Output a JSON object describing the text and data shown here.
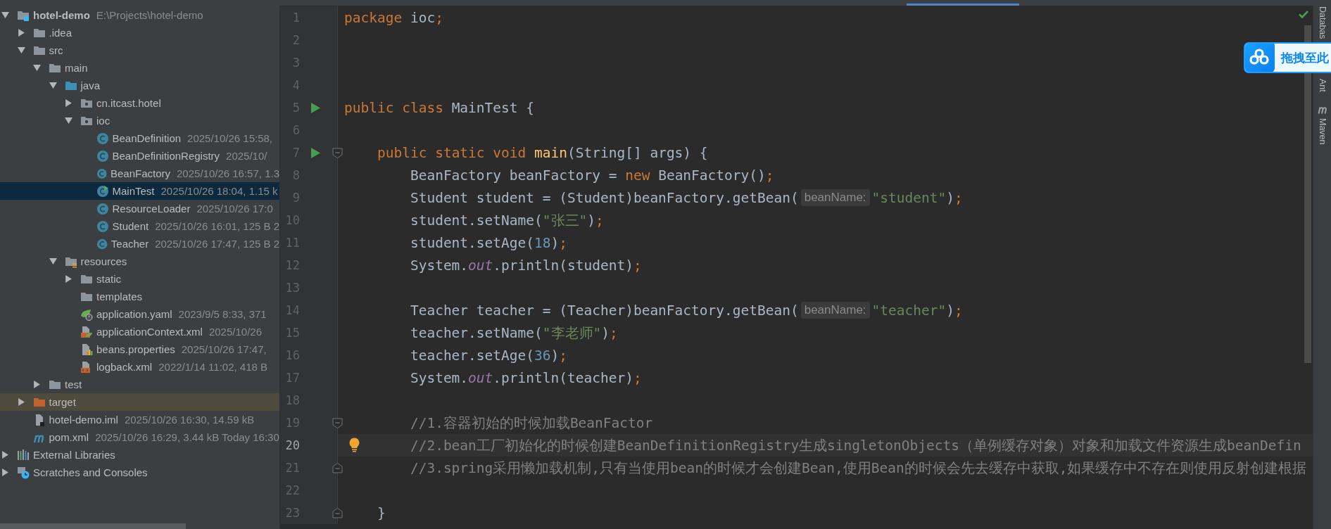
{
  "project_tree": {
    "items": [
      {
        "label": "hotel-demo",
        "meta": "E:\\Projects\\hotel-demo",
        "kind": "module",
        "expanded": true,
        "selected": false,
        "marked": false,
        "children": [
          {
            "label": ".idea",
            "kind": "folder",
            "expanded": false,
            "selected": false,
            "marked": false
          },
          {
            "label": "src",
            "kind": "folder",
            "expanded": true,
            "selected": false,
            "marked": false,
            "children": [
              {
                "label": "main",
                "kind": "folder",
                "expanded": true,
                "selected": false,
                "marked": false,
                "children": [
                  {
                    "label": "java",
                    "kind": "source",
                    "expanded": true,
                    "selected": false,
                    "marked": false,
                    "children": [
                      {
                        "label": "cn.itcast.hotel",
                        "kind": "package",
                        "expanded": false,
                        "selected": false,
                        "marked": false
                      },
                      {
                        "label": "ioc",
                        "kind": "package",
                        "expanded": true,
                        "selected": false,
                        "marked": false,
                        "children": [
                          {
                            "label": "BeanDefinition",
                            "meta": "2025/10/26 15:58,",
                            "kind": "class",
                            "selected": false,
                            "marked": false
                          },
                          {
                            "label": "BeanDefinitionRegistry",
                            "meta": "2025/10/",
                            "kind": "class",
                            "selected": false,
                            "marked": false
                          },
                          {
                            "label": "BeanFactory",
                            "meta": "2025/10/26 16:57, 1.3",
                            "kind": "class",
                            "selected": false,
                            "marked": false
                          },
                          {
                            "label": "MainTest",
                            "meta": "2025/10/26 18:04, 1.15 k",
                            "kind": "runnable",
                            "selected": true,
                            "marked": false
                          },
                          {
                            "label": "ResourceLoader",
                            "meta": "2025/10/26 17:0",
                            "kind": "class",
                            "selected": false,
                            "marked": false
                          },
                          {
                            "label": "Student",
                            "meta": "2025/10/26 16:01, 125 B 2",
                            "kind": "class",
                            "selected": false,
                            "marked": false
                          },
                          {
                            "label": "Teacher",
                            "meta": "2025/10/26 17:47, 125 B 2",
                            "kind": "class",
                            "selected": false,
                            "marked": false
                          }
                        ]
                      }
                    ]
                  },
                  {
                    "label": "resources",
                    "kind": "resources",
                    "expanded": true,
                    "selected": false,
                    "marked": false,
                    "children": [
                      {
                        "label": "static",
                        "kind": "folder",
                        "expanded": false,
                        "selected": false,
                        "marked": false
                      },
                      {
                        "label": "templates",
                        "kind": "folder",
                        "selected": false,
                        "marked": false
                      },
                      {
                        "label": "application.yaml",
                        "meta": "2023/9/5 8:33, 371",
                        "kind": "yaml",
                        "selected": false,
                        "marked": false
                      },
                      {
                        "label": "applicationContext.xml",
                        "meta": "2025/10/26",
                        "kind": "context",
                        "selected": false,
                        "marked": false
                      },
                      {
                        "label": "beans.properties",
                        "meta": "2025/10/26 17:47,",
                        "kind": "properties",
                        "selected": false,
                        "marked": false
                      },
                      {
                        "label": "logback.xml",
                        "meta": "2022/1/14 11:02, 418 B",
                        "kind": "xml",
                        "selected": false,
                        "marked": false
                      }
                    ]
                  }
                ]
              },
              {
                "label": "test",
                "kind": "folder",
                "expanded": false,
                "selected": false,
                "marked": false
              }
            ]
          },
          {
            "label": "target",
            "kind": "excluded",
            "expanded": false,
            "selected": false,
            "marked": true
          },
          {
            "label": "hotel-demo.iml",
            "meta": "2025/10/26 16:30, 14.59 kB",
            "kind": "iml",
            "selected": false,
            "marked": false
          },
          {
            "label": "pom.xml",
            "meta": "2025/10/26 16:29, 3.44 kB Today 16:30",
            "kind": "maven",
            "selected": false,
            "marked": false
          }
        ]
      },
      {
        "label": "External Libraries",
        "kind": "libraries",
        "expanded": false,
        "selected": false,
        "marked": false
      },
      {
        "label": "Scratches and Consoles",
        "kind": "scratches",
        "expanded": false,
        "selected": false,
        "marked": false
      }
    ]
  },
  "editor": {
    "lines": [
      {
        "number": "1",
        "current": false,
        "tokens": [
          {
            "kind": "keyword",
            "text": "package"
          },
          {
            "kind": "plain",
            "text": " ioc"
          },
          {
            "kind": "keyword",
            "text": ";"
          }
        ]
      },
      {
        "number": "2",
        "current": false
      },
      {
        "number": "3",
        "current": false
      },
      {
        "number": "4",
        "current": false
      },
      {
        "number": "5",
        "current": false,
        "run": true,
        "tokens": [
          {
            "kind": "keyword",
            "text": "public class"
          },
          {
            "kind": "plain",
            "text": " MainTest {"
          }
        ]
      },
      {
        "number": "6",
        "current": false
      },
      {
        "number": "7",
        "current": false,
        "run": true,
        "fold_open": true,
        "tokens": [
          {
            "kind": "keyword",
            "text": "    public static void"
          },
          {
            "kind": "method",
            "text": " main"
          },
          {
            "kind": "plain",
            "text": "(String[] args) {"
          }
        ]
      },
      {
        "number": "8",
        "current": false,
        "tokens": [
          {
            "kind": "plain",
            "text": "        BeanFactory beanFactory = "
          },
          {
            "kind": "keyword",
            "text": "new"
          },
          {
            "kind": "plain",
            "text": " BeanFactory()"
          },
          {
            "kind": "keyword",
            "text": ";"
          }
        ]
      },
      {
        "number": "9",
        "current": false,
        "tokens": [
          {
            "kind": "plain",
            "text": "        Student student = (Student)beanFactory.getBean("
          },
          {
            "kind": "hint",
            "text": "beanName:"
          },
          {
            "kind": "string",
            "text": "\"student\""
          },
          {
            "kind": "plain",
            "text": ")"
          },
          {
            "kind": "keyword",
            "text": ";"
          }
        ]
      },
      {
        "number": "10",
        "current": false,
        "tokens": [
          {
            "kind": "plain",
            "text": "        student.setName("
          },
          {
            "kind": "string",
            "text": "\"张三\""
          },
          {
            "kind": "plain",
            "text": ")"
          },
          {
            "kind": "keyword",
            "text": ";"
          }
        ]
      },
      {
        "number": "11",
        "current": false,
        "tokens": [
          {
            "kind": "plain",
            "text": "        student.setAge("
          },
          {
            "kind": "number",
            "text": "18"
          },
          {
            "kind": "plain",
            "text": ")"
          },
          {
            "kind": "keyword",
            "text": ";"
          }
        ]
      },
      {
        "number": "12",
        "current": false,
        "tokens": [
          {
            "kind": "plain",
            "text": "        System."
          },
          {
            "kind": "static",
            "text": "out"
          },
          {
            "kind": "plain",
            "text": ".println(student)"
          },
          {
            "kind": "keyword",
            "text": ";"
          }
        ]
      },
      {
        "number": "13",
        "current": false
      },
      {
        "number": "14",
        "current": false,
        "tokens": [
          {
            "kind": "plain",
            "text": "        Teacher teacher = (Teacher)beanFactory.getBean("
          },
          {
            "kind": "hint",
            "text": "beanName:"
          },
          {
            "kind": "string",
            "text": "\"teacher\""
          },
          {
            "kind": "plain",
            "text": ")"
          },
          {
            "kind": "keyword",
            "text": ";"
          }
        ]
      },
      {
        "number": "15",
        "current": false,
        "tokens": [
          {
            "kind": "plain",
            "text": "        teacher.setName("
          },
          {
            "kind": "string",
            "text": "\"李老师\""
          },
          {
            "kind": "plain",
            "text": ")"
          },
          {
            "kind": "keyword",
            "text": ";"
          }
        ]
      },
      {
        "number": "16",
        "current": false,
        "tokens": [
          {
            "kind": "plain",
            "text": "        teacher.setAge("
          },
          {
            "kind": "number",
            "text": "36"
          },
          {
            "kind": "plain",
            "text": ")"
          },
          {
            "kind": "keyword",
            "text": ";"
          }
        ]
      },
      {
        "number": "17",
        "current": false,
        "tokens": [
          {
            "kind": "plain",
            "text": "        System."
          },
          {
            "kind": "static",
            "text": "out"
          },
          {
            "kind": "plain",
            "text": ".println(teacher)"
          },
          {
            "kind": "keyword",
            "text": ";"
          }
        ]
      },
      {
        "number": "18",
        "current": false
      },
      {
        "number": "19",
        "current": false,
        "fold_open": true,
        "tokens": [
          {
            "kind": "comment",
            "text": "        //1.容器初始的时候加载BeanFactor"
          }
        ]
      },
      {
        "number": "20",
        "current": true,
        "bulb": true,
        "tokens": [
          {
            "kind": "comment",
            "text": "        //2.bean工厂初始化的时候创建BeanDefinitionRegistry生成singletonObjects（单例缓存对象）对象和加载文件资源生成beanDefin"
          }
        ]
      },
      {
        "number": "21",
        "current": false,
        "fold_close": true,
        "tokens": [
          {
            "kind": "comment",
            "text": "        //3.spring采用懒加载机制,只有当使用bean的时候才会创建Bean,使用Bean的时候会先去缓存中获取,如果缓存中不存在则使用反射创建根据"
          }
        ]
      },
      {
        "number": "22",
        "current": false
      },
      {
        "number": "23",
        "current": false,
        "fold_close": true,
        "tokens": [
          {
            "kind": "plain",
            "text": "    }"
          }
        ]
      }
    ]
  },
  "tool_strip": {
    "items": [
      {
        "label": "Databas",
        "kind": "plain"
      },
      {
        "label": "Ant",
        "kind": "plain"
      },
      {
        "label": "Maven",
        "kind": "maven"
      }
    ]
  },
  "upload_popup": {
    "label": "拖拽至此"
  }
}
